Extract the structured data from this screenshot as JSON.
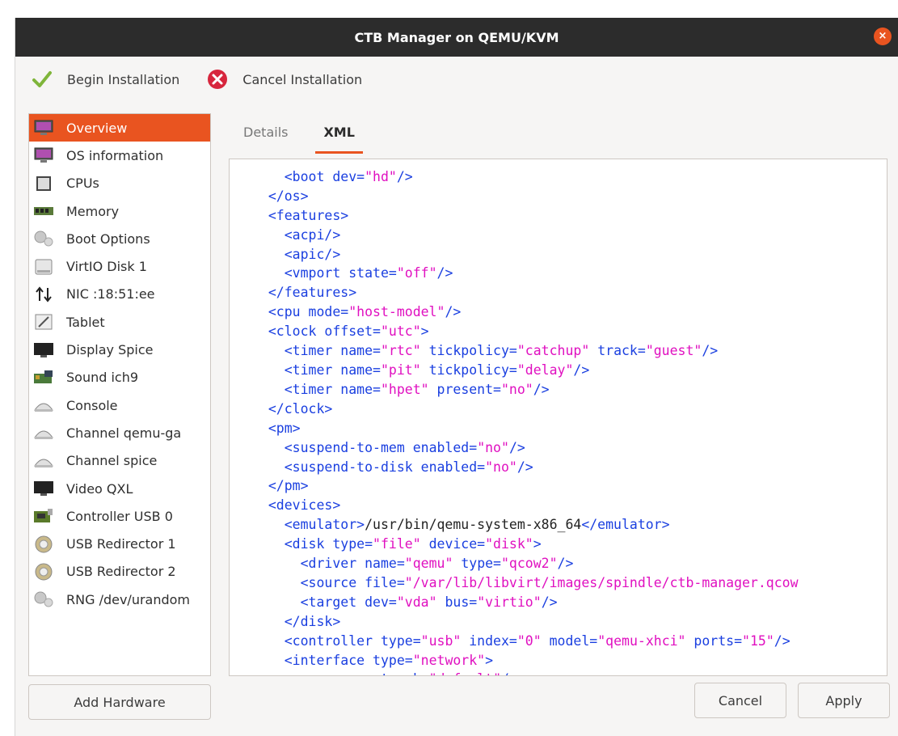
{
  "window": {
    "title": "CTB Manager on QEMU/KVM",
    "close_glyph": "×"
  },
  "toolbar": {
    "begin_label": "Begin Installation",
    "cancel_label": "Cancel Installation",
    "begin_icon": "checkmark-icon",
    "cancel_icon": "cancel-icon"
  },
  "sidebar": {
    "items": [
      {
        "label": "Overview",
        "icon": "monitor-icon",
        "active": true
      },
      {
        "label": "OS information",
        "icon": "monitor-icon"
      },
      {
        "label": "CPUs",
        "icon": "cpu-icon"
      },
      {
        "label": "Memory",
        "icon": "memory-icon"
      },
      {
        "label": "Boot Options",
        "icon": "gears-icon"
      },
      {
        "label": "VirtIO Disk 1",
        "icon": "disk-icon"
      },
      {
        "label": "NIC :18:51:ee",
        "icon": "network-icon"
      },
      {
        "label": "Tablet",
        "icon": "tablet-icon"
      },
      {
        "label": "Display Spice",
        "icon": "display-icon"
      },
      {
        "label": "Sound ich9",
        "icon": "sound-card-icon"
      },
      {
        "label": "Console",
        "icon": "serial-icon"
      },
      {
        "label": "Channel qemu-ga",
        "icon": "serial-icon"
      },
      {
        "label": "Channel spice",
        "icon": "serial-icon"
      },
      {
        "label": "Video QXL",
        "icon": "display-icon"
      },
      {
        "label": "Controller USB 0",
        "icon": "controller-icon"
      },
      {
        "label": "USB Redirector 1",
        "icon": "usb-icon"
      },
      {
        "label": "USB Redirector 2",
        "icon": "usb-icon"
      },
      {
        "label": "RNG /dev/urandom",
        "icon": "gears-icon"
      }
    ],
    "add_hardware_label": "Add Hardware"
  },
  "tabs": [
    {
      "label": "Details",
      "active": false
    },
    {
      "label": "XML",
      "active": true
    }
  ],
  "xml_lines": [
    [
      [
        "tx",
        "  "
      ],
      [
        "tg",
        "<boot "
      ],
      [
        "at",
        "dev="
      ],
      [
        "vl",
        "\"hd\""
      ],
      [
        "tg",
        "/>"
      ]
    ],
    [
      [
        "tg",
        "</os>"
      ]
    ],
    [
      [
        "tg",
        "<features>"
      ]
    ],
    [
      [
        "tx",
        "  "
      ],
      [
        "tg",
        "<acpi/>"
      ]
    ],
    [
      [
        "tx",
        "  "
      ],
      [
        "tg",
        "<apic/>"
      ]
    ],
    [
      [
        "tx",
        "  "
      ],
      [
        "tg",
        "<vmport "
      ],
      [
        "at",
        "state="
      ],
      [
        "vl",
        "\"off\""
      ],
      [
        "tg",
        "/>"
      ]
    ],
    [
      [
        "tg",
        "</features>"
      ]
    ],
    [
      [
        "tg",
        "<cpu "
      ],
      [
        "at",
        "mode="
      ],
      [
        "vl",
        "\"host-model\""
      ],
      [
        "tg",
        "/>"
      ]
    ],
    [
      [
        "tg",
        "<clock "
      ],
      [
        "at",
        "offset="
      ],
      [
        "vl",
        "\"utc\""
      ],
      [
        "tg",
        ">"
      ]
    ],
    [
      [
        "tx",
        "  "
      ],
      [
        "tg",
        "<timer "
      ],
      [
        "at",
        "name="
      ],
      [
        "vl",
        "\"rtc\""
      ],
      [
        "at",
        " tickpolicy="
      ],
      [
        "vl",
        "\"catchup\""
      ],
      [
        "at",
        " track="
      ],
      [
        "vl",
        "\"guest\""
      ],
      [
        "tg",
        "/>"
      ]
    ],
    [
      [
        "tx",
        "  "
      ],
      [
        "tg",
        "<timer "
      ],
      [
        "at",
        "name="
      ],
      [
        "vl",
        "\"pit\""
      ],
      [
        "at",
        " tickpolicy="
      ],
      [
        "vl",
        "\"delay\""
      ],
      [
        "tg",
        "/>"
      ]
    ],
    [
      [
        "tx",
        "  "
      ],
      [
        "tg",
        "<timer "
      ],
      [
        "at",
        "name="
      ],
      [
        "vl",
        "\"hpet\""
      ],
      [
        "at",
        " present="
      ],
      [
        "vl",
        "\"no\""
      ],
      [
        "tg",
        "/>"
      ]
    ],
    [
      [
        "tg",
        "</clock>"
      ]
    ],
    [
      [
        "tg",
        "<pm>"
      ]
    ],
    [
      [
        "tx",
        "  "
      ],
      [
        "tg",
        "<suspend-to-mem "
      ],
      [
        "at",
        "enabled="
      ],
      [
        "vl",
        "\"no\""
      ],
      [
        "tg",
        "/>"
      ]
    ],
    [
      [
        "tx",
        "  "
      ],
      [
        "tg",
        "<suspend-to-disk "
      ],
      [
        "at",
        "enabled="
      ],
      [
        "vl",
        "\"no\""
      ],
      [
        "tg",
        "/>"
      ]
    ],
    [
      [
        "tg",
        "</pm>"
      ]
    ],
    [
      [
        "tg",
        "<devices>"
      ]
    ],
    [
      [
        "tx",
        "  "
      ],
      [
        "tg",
        "<emulator>"
      ],
      [
        "tx",
        "/usr/bin/qemu-system-x86_64"
      ],
      [
        "tg",
        "</emulator>"
      ]
    ],
    [
      [
        "tx",
        "  "
      ],
      [
        "tg",
        "<disk "
      ],
      [
        "at",
        "type="
      ],
      [
        "vl",
        "\"file\""
      ],
      [
        "at",
        " device="
      ],
      [
        "vl",
        "\"disk\""
      ],
      [
        "tg",
        ">"
      ]
    ],
    [
      [
        "tx",
        "    "
      ],
      [
        "tg",
        "<driver "
      ],
      [
        "at",
        "name="
      ],
      [
        "vl",
        "\"qemu\""
      ],
      [
        "at",
        " type="
      ],
      [
        "vl",
        "\"qcow2\""
      ],
      [
        "tg",
        "/>"
      ]
    ],
    [
      [
        "tx",
        "    "
      ],
      [
        "tg",
        "<source "
      ],
      [
        "at",
        "file="
      ],
      [
        "vl",
        "\"/var/lib/libvirt/images/spindle/ctb-manager.qcow"
      ]
    ],
    [
      [
        "tx",
        "    "
      ],
      [
        "tg",
        "<target "
      ],
      [
        "at",
        "dev="
      ],
      [
        "vl",
        "\"vda\""
      ],
      [
        "at",
        " bus="
      ],
      [
        "vl",
        "\"virtio\""
      ],
      [
        "tg",
        "/>"
      ]
    ],
    [
      [
        "tx",
        "  "
      ],
      [
        "tg",
        "</disk>"
      ]
    ],
    [
      [
        "tx",
        "  "
      ],
      [
        "tg",
        "<controller "
      ],
      [
        "at",
        "type="
      ],
      [
        "vl",
        "\"usb\""
      ],
      [
        "at",
        " index="
      ],
      [
        "vl",
        "\"0\""
      ],
      [
        "at",
        " model="
      ],
      [
        "vl",
        "\"qemu-xhci\""
      ],
      [
        "at",
        " ports="
      ],
      [
        "vl",
        "\"15\""
      ],
      [
        "tg",
        "/>"
      ]
    ],
    [
      [
        "tx",
        "  "
      ],
      [
        "tg",
        "<interface "
      ],
      [
        "at",
        "type="
      ],
      [
        "vl",
        "\"network\""
      ],
      [
        "tg",
        ">"
      ]
    ],
    [
      [
        "tx",
        "    "
      ],
      [
        "tg",
        "<source "
      ],
      [
        "at",
        "network="
      ],
      [
        "vl",
        "\"default\""
      ],
      [
        "tg",
        "/>"
      ]
    ]
  ],
  "buttons": {
    "cancel_label": "Cancel",
    "apply_label": "Apply"
  },
  "colors": {
    "accent": "#e95420",
    "titlebar": "#2c2c2c",
    "xml_tag": "#1a3fe0",
    "xml_value": "#e010c0"
  }
}
